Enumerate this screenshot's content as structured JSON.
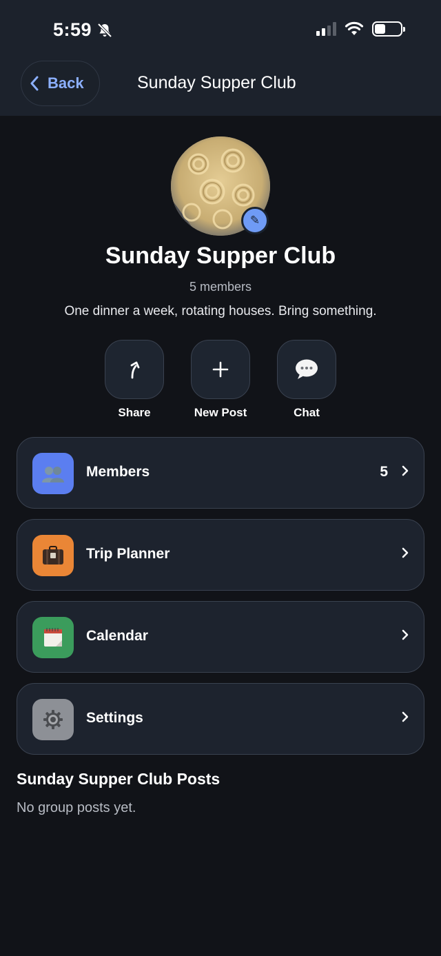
{
  "status_bar": {
    "time": "5:59",
    "icons": [
      "silent-bell-icon",
      "signal-icon",
      "wifi-icon",
      "battery-icon"
    ]
  },
  "nav": {
    "back_label": "Back",
    "title": "Sunday Supper Club"
  },
  "group": {
    "name": "Sunday Supper Club",
    "members": "5 members",
    "description": "One dinner a week, rotating houses. Bring something."
  },
  "actions": [
    {
      "label": "Share",
      "icon": "share-icon"
    },
    {
      "label": "New Post",
      "icon": "plus-icon"
    },
    {
      "label": "Chat",
      "icon": "chat-icon"
    }
  ],
  "rows": [
    {
      "label": "Members",
      "count": "5",
      "icon": "members-icon",
      "color": "#5b7ef0"
    },
    {
      "label": "Trip Planner",
      "count": "",
      "icon": "suitcase-icon",
      "color": "#ea8636"
    },
    {
      "label": "Calendar",
      "count": "",
      "icon": "calendar-icon",
      "color": "#3b9c5c"
    },
    {
      "label": "Settings",
      "count": "",
      "icon": "gear-icon",
      "color": "#8d9096"
    }
  ],
  "posts": {
    "title": "Sunday Supper Club Posts",
    "empty_text": "No group posts yet."
  },
  "colors": {
    "accent": "#8cb0ff",
    "background": "#111318",
    "header": "#1c222c",
    "card": "#1d232e"
  }
}
